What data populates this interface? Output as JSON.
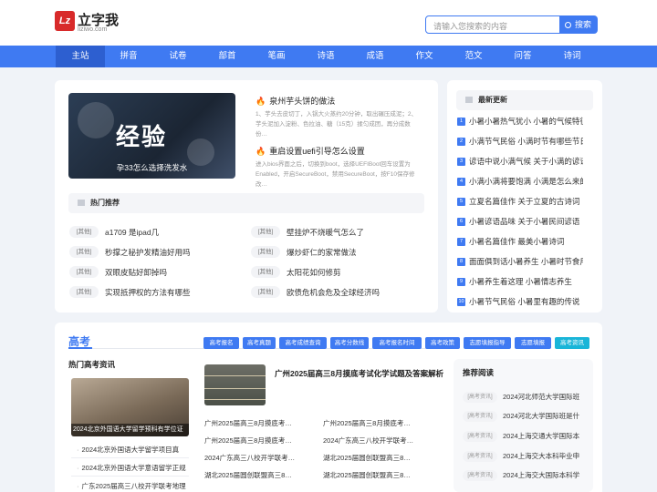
{
  "logo": {
    "mark": "Lz",
    "name": "立字我",
    "domain": "liziwo.com"
  },
  "search": {
    "placeholder": "请输入您搜索的内容",
    "button": "搜索"
  },
  "nav": [
    "主站",
    "拼音",
    "试卷",
    "部首",
    "笔画",
    "诗语",
    "成语",
    "作文",
    "范文",
    "问答",
    "诗词"
  ],
  "featured": {
    "banner_title": "经验",
    "banner_caption": "孕33怎么选择洗发水",
    "articles": [
      {
        "title": "泉州芋头饼的做法",
        "desc": "1、芋头去皮切丁，入锅大火蒸约20分钟，取出碾压成泥；2、芋头泥加入淀粉、色拉油、糖（15克）揉匀成团，再分成数份…"
      },
      {
        "title": "重启设置uefi引导怎么设置",
        "desc": "进入bios界面之后，切换到boot，选择UEFIBoot回车设置为Enabled，开启SecureBoot，禁用SecureBoot，按F10保存修改…"
      }
    ]
  },
  "hot_recommend": {
    "heading": "热门推荐",
    "items": [
      {
        "tag": "[其他]",
        "text": "a1709 是ipad几"
      },
      {
        "tag": "[其他]",
        "text": "壁挂炉不烧暖气怎么了"
      },
      {
        "tag": "[其他]",
        "text": "秒撑之秘护发精油好用吗"
      },
      {
        "tag": "[其他]",
        "text": "爆炒虾仁的家常做法"
      },
      {
        "tag": "[其他]",
        "text": "双眼皮贴好卸掉吗"
      },
      {
        "tag": "[其他]",
        "text": "太阳花如何修剪"
      },
      {
        "tag": "[其他]",
        "text": "实现抵押权的方法有哪些"
      },
      {
        "tag": "[其他]",
        "text": "欧债危机会危及全球经济吗"
      }
    ]
  },
  "latest": {
    "heading": "最新更新",
    "items": [
      {
        "num": "1",
        "text": "小暑小暑热气犹小 小暑的气候特征"
      },
      {
        "num": "2",
        "text": "小满节气民俗 小满时节有哪些节日…"
      },
      {
        "num": "3",
        "text": "谚语中说小满气候 关于小满的谚语"
      },
      {
        "num": "4",
        "text": "小满小满将要饱满 小满是怎么来的"
      },
      {
        "num": "5",
        "text": "立夏名篇佳作 关于立夏的古诗词"
      },
      {
        "num": "6",
        "text": "小暑谚语品味 关于小暑民间谚语"
      },
      {
        "num": "7",
        "text": "小暑名篇佳作 最美小暑诗词"
      },
      {
        "num": "8",
        "text": "面面俱到话小暑养生 小暑时节食用…"
      },
      {
        "num": "9",
        "text": "小暑养生着这理 小暑情志养生"
      },
      {
        "num": "10",
        "text": "小暑节气民俗 小暑里有趣的传说"
      }
    ]
  },
  "gaokao": {
    "title": "高考",
    "chips": [
      "高考报名",
      "高考真题",
      "高考成绩查询",
      "高考分数线",
      "高考报名时间",
      "高考政策",
      "志愿填报指导",
      "志愿填报",
      "高考资讯"
    ],
    "hot_heading": "热门高考资讯",
    "hot_image_caption": "2024北京外国语大学留学预科有学位证",
    "hot_links": [
      "2024北京外国语大学留学项目真",
      "2024北京外国语大学意语留学正规",
      "广东2025届高三八校开学联考地理"
    ],
    "mid_headline": "广州2025届高三8月摸底考试化学试题及答案解析",
    "mid_links": [
      "广州2025届高三8月摸底考…",
      "广州2025届高三8月摸底考…",
      "广州2025届高三8月摸底考…",
      "2024广东高三八校开学联考…",
      "2024广东高三八校开学联考…",
      "湖北2025届圆创联盟高三8…",
      "湖北2025届圆创联盟高三8…",
      "湖北2025届圆创联盟高三8…"
    ],
    "recommend_heading": "推荐阅读",
    "recommend": [
      {
        "tag": "[高考资讯]",
        "text": "2024河北师范大学国际班"
      },
      {
        "tag": "[高考资讯]",
        "text": "2024河北大学国际班是什"
      },
      {
        "tag": "[高考资讯]",
        "text": "2024上海交通大学国际本"
      },
      {
        "tag": "[高考资讯]",
        "text": "2024上海交大本科毕业申"
      },
      {
        "tag": "[高考资讯]",
        "text": "2024上海交大国际本科学"
      }
    ]
  }
}
